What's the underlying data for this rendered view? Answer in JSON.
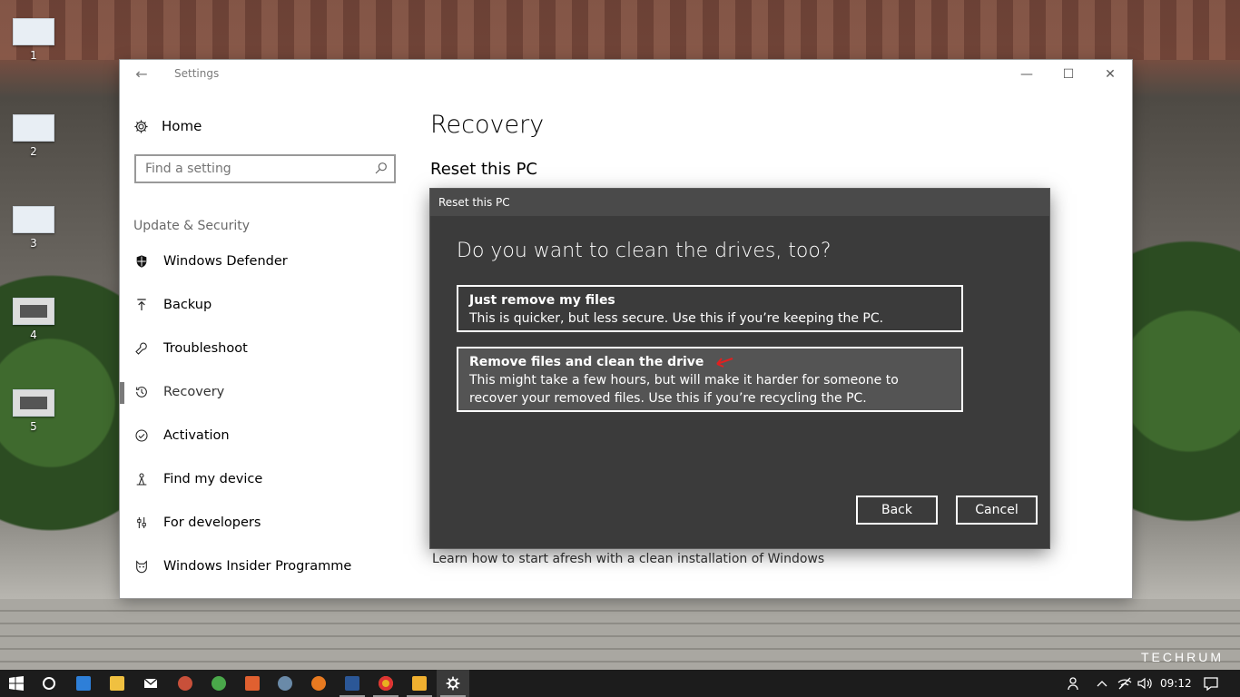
{
  "desktop": {
    "icons": [
      {
        "label": "1"
      },
      {
        "label": "2"
      },
      {
        "label": "3"
      },
      {
        "label": "4"
      },
      {
        "label": "5"
      }
    ],
    "watermark": "TECHRUM"
  },
  "window": {
    "title": "Settings",
    "home_label": "Home",
    "search_placeholder": "Find a setting",
    "section_label": "Update & Security",
    "nav_items": [
      {
        "label": "Windows Defender",
        "icon": "shield-icon"
      },
      {
        "label": "Backup",
        "icon": "backup-arrow-icon"
      },
      {
        "label": "Troubleshoot",
        "icon": "wrench-icon"
      },
      {
        "label": "Recovery",
        "icon": "history-icon",
        "selected": true
      },
      {
        "label": "Activation",
        "icon": "check-circle-icon"
      },
      {
        "label": "Find my device",
        "icon": "person-pin-icon"
      },
      {
        "label": "For developers",
        "icon": "developer-sliders-icon"
      },
      {
        "label": "Windows Insider Programme",
        "icon": "insider-cat-icon"
      }
    ],
    "page_title": "Recovery",
    "sub_title": "Reset this PC",
    "learn_link": "Learn how to start afresh with a clean installation of Windows"
  },
  "dialog": {
    "title": "Reset this PC",
    "heading": "Do you want to clean the drives, too?",
    "options": [
      {
        "title": "Just remove my files",
        "description": "This is quicker, but less secure. Use this if you’re keeping the PC."
      },
      {
        "title": "Remove files and clean the drive",
        "description": "This might take a few hours, but will make it harder for someone to recover your removed files. Use this if you’re recycling the PC."
      }
    ],
    "back_label": "Back",
    "cancel_label": "Cancel"
  },
  "taskbar": {
    "clock": "09:12",
    "apps": [
      "start-icon",
      "cortana-icon",
      "gotv-icon",
      "file-explorer-icon",
      "mail-icon",
      "app-icon-1",
      "app-icon-2",
      "app-icon-3",
      "app-icon-4",
      "firefox-icon",
      "word-icon",
      "chrome-icon",
      "media-player-icon",
      "settings-icon"
    ]
  }
}
